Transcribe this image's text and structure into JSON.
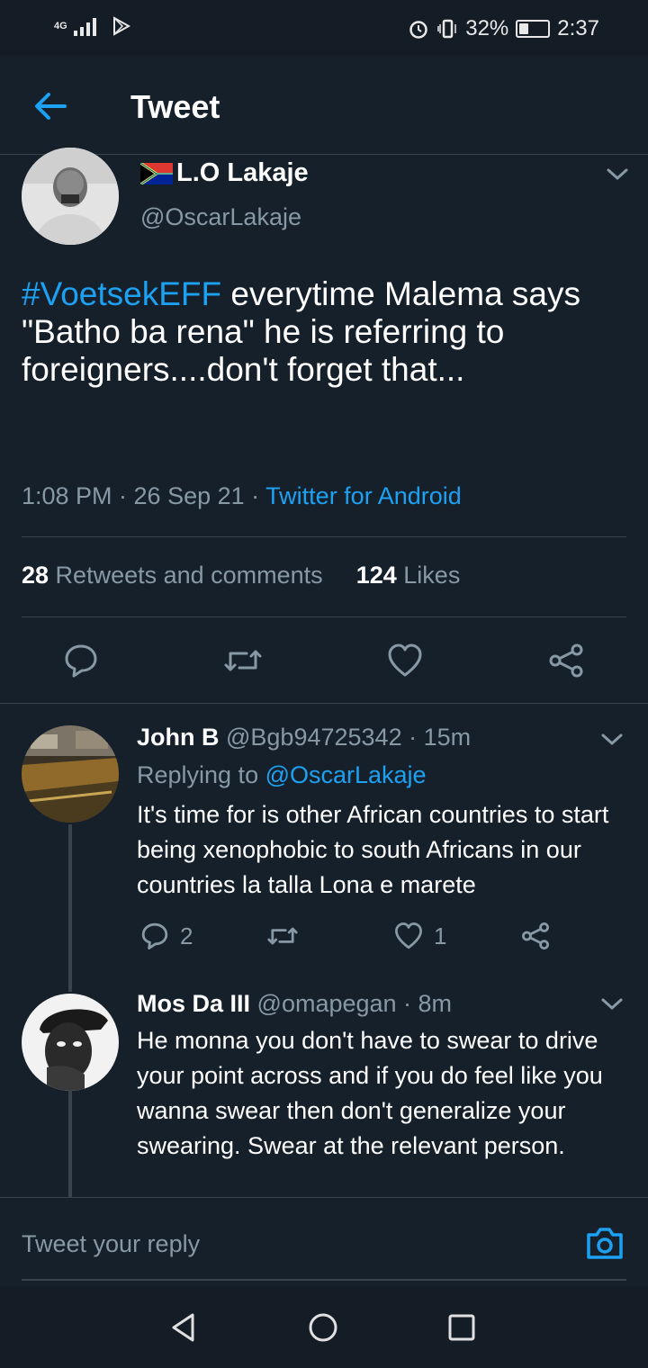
{
  "status_bar": {
    "network": "4G",
    "battery_percent": "32%",
    "battery_level": 0.32,
    "time": "2:37"
  },
  "header": {
    "title": "Tweet"
  },
  "tweet": {
    "author_name": "L.O Lakaje",
    "author_handle": "@OscarLakaje",
    "hashtag": "#VoetsekEFF",
    "body": " everytime Malema says \"Batho ba rena\" he is referring to foreigners....don't forget that...",
    "timestamp": "1:08 PM · 26 Sep 21 · ",
    "source": "Twitter for Android",
    "retweets_count": "28",
    "retweets_label": " Retweets and comments",
    "likes_count": "124",
    "likes_label": " Likes"
  },
  "replies": [
    {
      "name": "John B",
      "handle_time": " @Bgb94725342 · 15m",
      "replying_prefix": "Replying to ",
      "replying_to": "@OscarLakaje",
      "text": "It's time for is other African countries to start being xenophobic to south Africans in our countries la talla Lona e marete",
      "reply_count": "2",
      "like_count": "1"
    },
    {
      "name": "Mos Da III",
      "handle_time": " @omapegan · 8m",
      "text": "He monna you don't have to swear to drive your point across and if you do feel like you wanna swear then don't generalize your swearing. Swear at the relevant person."
    }
  ],
  "compose": {
    "placeholder": "Tweet your reply"
  },
  "colors": {
    "background": "#15202b",
    "accent": "#1da1f2",
    "secondary_text": "#8899a6",
    "divider": "#38444d"
  },
  "icons": [
    "back-arrow-icon",
    "chevron-down-icon",
    "reply-icon",
    "retweet-icon",
    "like-icon",
    "share-icon",
    "camera-icon",
    "nav-back-icon",
    "nav-home-icon",
    "nav-recents-icon"
  ]
}
